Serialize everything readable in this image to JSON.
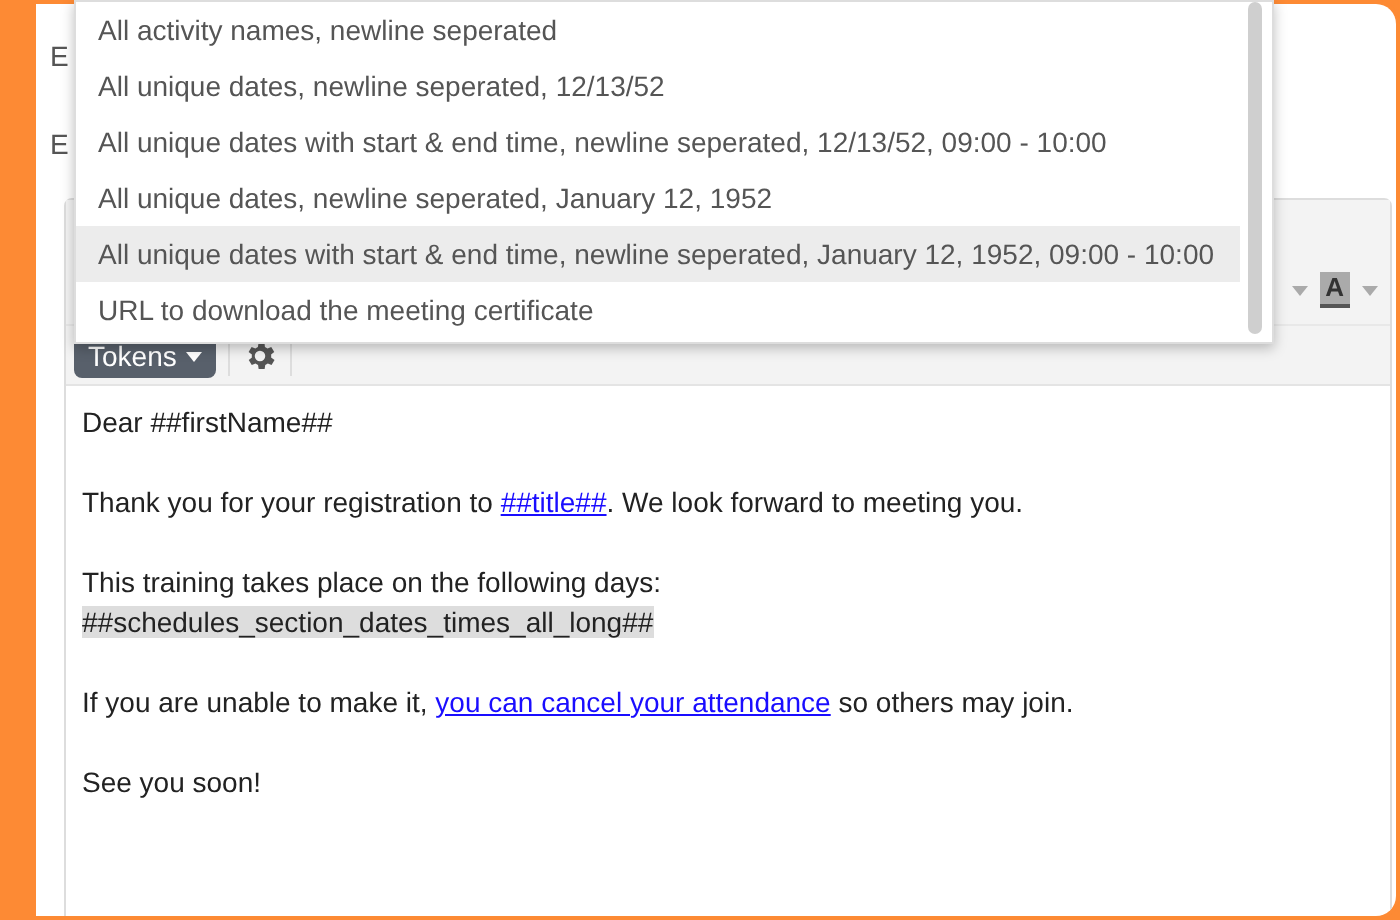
{
  "background_labels": [
    "E",
    "E"
  ],
  "dropdown": {
    "items": [
      {
        "label": "All activity names, newline seperated",
        "selected": false
      },
      {
        "label": "All unique dates, newline seperated, 12/13/52",
        "selected": false
      },
      {
        "label": "All unique dates with start & end time, newline seperated, 12/13/52, 09:00 - 10:00",
        "selected": false
      },
      {
        "label": "All unique dates, newline seperated, January 12, 1952",
        "selected": false
      },
      {
        "label": "All unique dates with start & end time, newline seperated, January 12, 1952, 09:00 - 10:00",
        "selected": true
      },
      {
        "label": "URL to download the meeting certificate",
        "selected": false
      }
    ]
  },
  "toolbar": {
    "font_color_letter": "A",
    "tokens_button": "Tokens"
  },
  "editor": {
    "blocks": [
      [
        [
          {
            "kind": "text",
            "text": "Dear ##firstName##"
          }
        ]
      ],
      [
        [
          {
            "kind": "text",
            "text": "Thank you for your registration to "
          },
          {
            "kind": "link",
            "text": "##title##"
          },
          {
            "kind": "text",
            "text": ". We look forward to meeting you."
          }
        ]
      ],
      [
        [
          {
            "kind": "text",
            "text": "This training takes place on the following days:"
          }
        ],
        [
          {
            "kind": "token",
            "text": "##schedules_section_dates_times_all_long##"
          }
        ]
      ],
      [
        [
          {
            "kind": "text",
            "text": "If you are unable to make it, "
          },
          {
            "kind": "link",
            "text": "you can cancel your attendance"
          },
          {
            "kind": "text",
            "text": " so others may join."
          }
        ]
      ],
      [
        [
          {
            "kind": "text",
            "text": "See you soon!"
          }
        ]
      ]
    ]
  }
}
